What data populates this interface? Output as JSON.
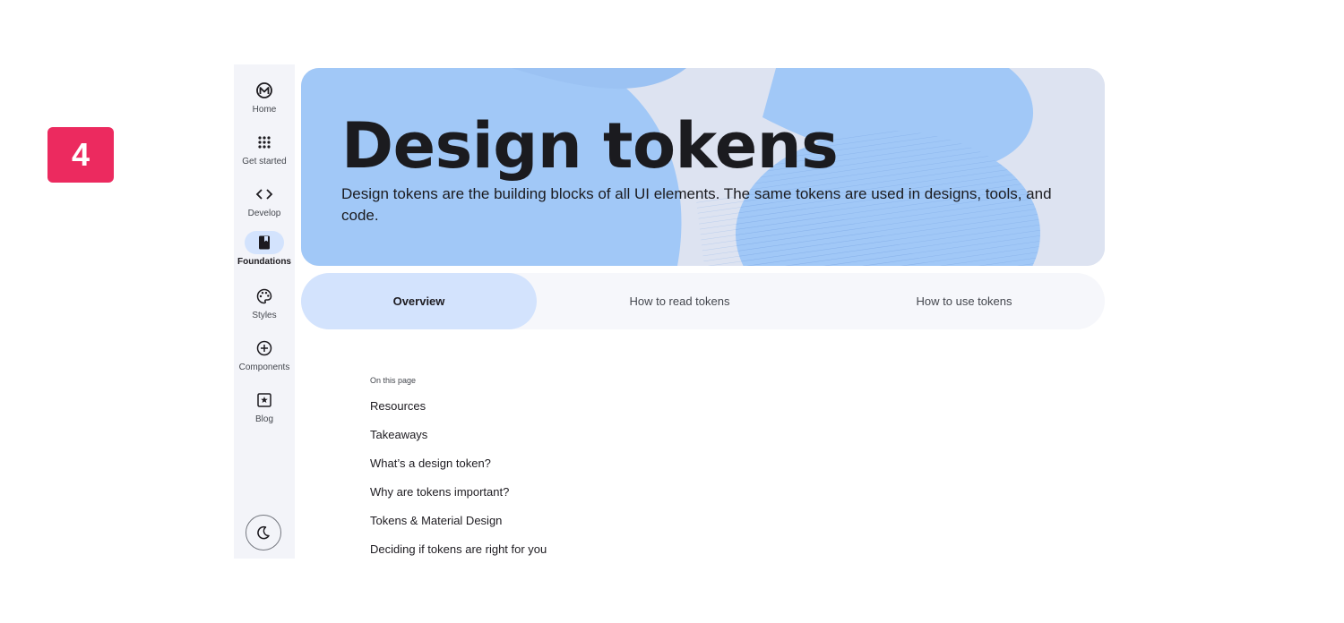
{
  "step_badge": "4",
  "nav_rail": {
    "items": [
      {
        "label": "Home",
        "icon": "material-logo-icon",
        "active": false
      },
      {
        "label": "Get started",
        "icon": "apps-grid-icon",
        "active": false
      },
      {
        "label": "Develop",
        "icon": "code-icon",
        "active": false
      },
      {
        "label": "Foundations",
        "icon": "book-icon",
        "active": true
      },
      {
        "label": "Styles",
        "icon": "palette-icon",
        "active": false
      },
      {
        "label": "Components",
        "icon": "add-circle-icon",
        "active": false
      },
      {
        "label": "Blog",
        "icon": "star-box-icon",
        "active": false
      }
    ],
    "theme_toggle_icon": "moon-icon"
  },
  "hero": {
    "title": "Design tokens",
    "description": "Design tokens are the building blocks of all UI elements. The same tokens are used in designs, tools, and code."
  },
  "tabs": [
    {
      "label": "Overview",
      "active": true
    },
    {
      "label": "How to read tokens",
      "active": false
    },
    {
      "label": "How to use tokens",
      "active": false
    }
  ],
  "toc": {
    "heading": "On this page",
    "links": [
      "Resources",
      "Takeaways",
      "What’s a design token?",
      "Why are tokens important?",
      "Tokens & Material Design",
      "Deciding if tokens are right for you"
    ]
  },
  "colors": {
    "accent_badge": "#ec2a5f",
    "active_indicator": "#d3e3fd",
    "hero_blue": "#a1c8f7",
    "rail_background": "#f3f4f9"
  }
}
